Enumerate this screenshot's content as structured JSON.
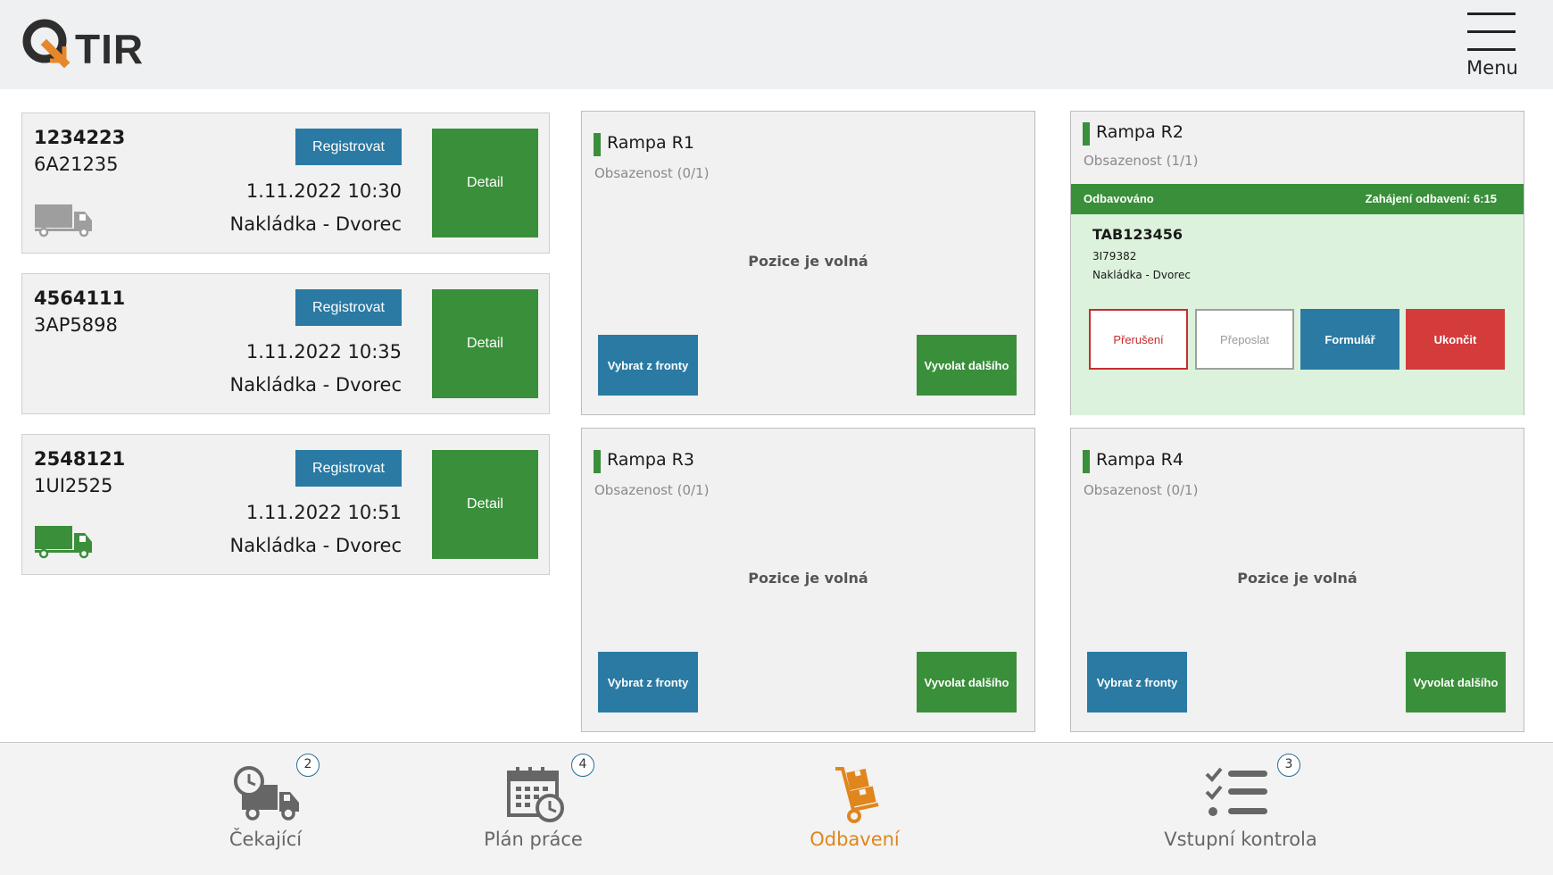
{
  "header": {
    "logo_text": "TIR",
    "menu_label": "Menu"
  },
  "vehicles": [
    {
      "id": "1234223",
      "plate": "6A21235",
      "datetime": "1.11.2022 10:30",
      "location": "Nakládka - Dvorec",
      "register_label": "Registrovat",
      "detail_label": "Detail",
      "truck_color": "#9e9e9e"
    },
    {
      "id": "4564111",
      "plate": "3AP5898",
      "datetime": "1.11.2022 10:35",
      "location": "Nakládka - Dvorec",
      "register_label": "Registrovat",
      "detail_label": "Detail"
    },
    {
      "id": "2548121",
      "plate": "1UI2525",
      "datetime": "1.11.2022 10:51",
      "location": "Nakládka - Dvorec",
      "register_label": "Registrovat",
      "detail_label": "Detail",
      "truck_color": "#3a8f3a"
    }
  ],
  "ramps": [
    {
      "title": "Rampa R1",
      "occupancy": "Obsazenost (0/1)",
      "free_text": "Pozice je volná",
      "queue_label": "Vybrat z fronty",
      "next_label": "Vyvolat dalšího"
    },
    {
      "title": "Rampa R2",
      "occupancy": "Obsazenost (1/1)",
      "status": "Odbavováno",
      "start_text": "Zahájení odbavení: 6:15",
      "vehicle_id": "TAB123456",
      "vehicle_sub": "3I79382",
      "vehicle_location": "Nakládka - Dvorec",
      "btn_interrupt": "Přerušení",
      "btn_forward": "Přeposlat",
      "btn_form": "Formulář",
      "btn_finish": "Ukončit"
    },
    {
      "title": "Rampa R3",
      "occupancy": "Obsazenost (0/1)",
      "free_text": "Pozice je volná",
      "queue_label": "Vybrat z fronty",
      "next_label": "Vyvolat dalšího"
    },
    {
      "title": "Rampa R4",
      "occupancy": "Obsazenost (0/1)",
      "free_text": "Pozice je volná",
      "queue_label": "Vybrat z fronty",
      "next_label": "Vyvolat dalšího"
    }
  ],
  "nav": [
    {
      "label": "Čekající",
      "badge": "2",
      "icon": "waiting-truck-icon"
    },
    {
      "label": "Plán práce",
      "badge": "4",
      "icon": "calendar-clock-icon"
    },
    {
      "label": "Odbavení",
      "icon": "hand-truck-icon",
      "active": true
    },
    {
      "label": "Vstupní kontrola",
      "badge": "3",
      "icon": "checklist-icon"
    }
  ],
  "colors": {
    "accent_orange": "#e0861d",
    "green": "#3a8f3a",
    "blue": "#2a7aa3",
    "red": "#d43b3b"
  }
}
